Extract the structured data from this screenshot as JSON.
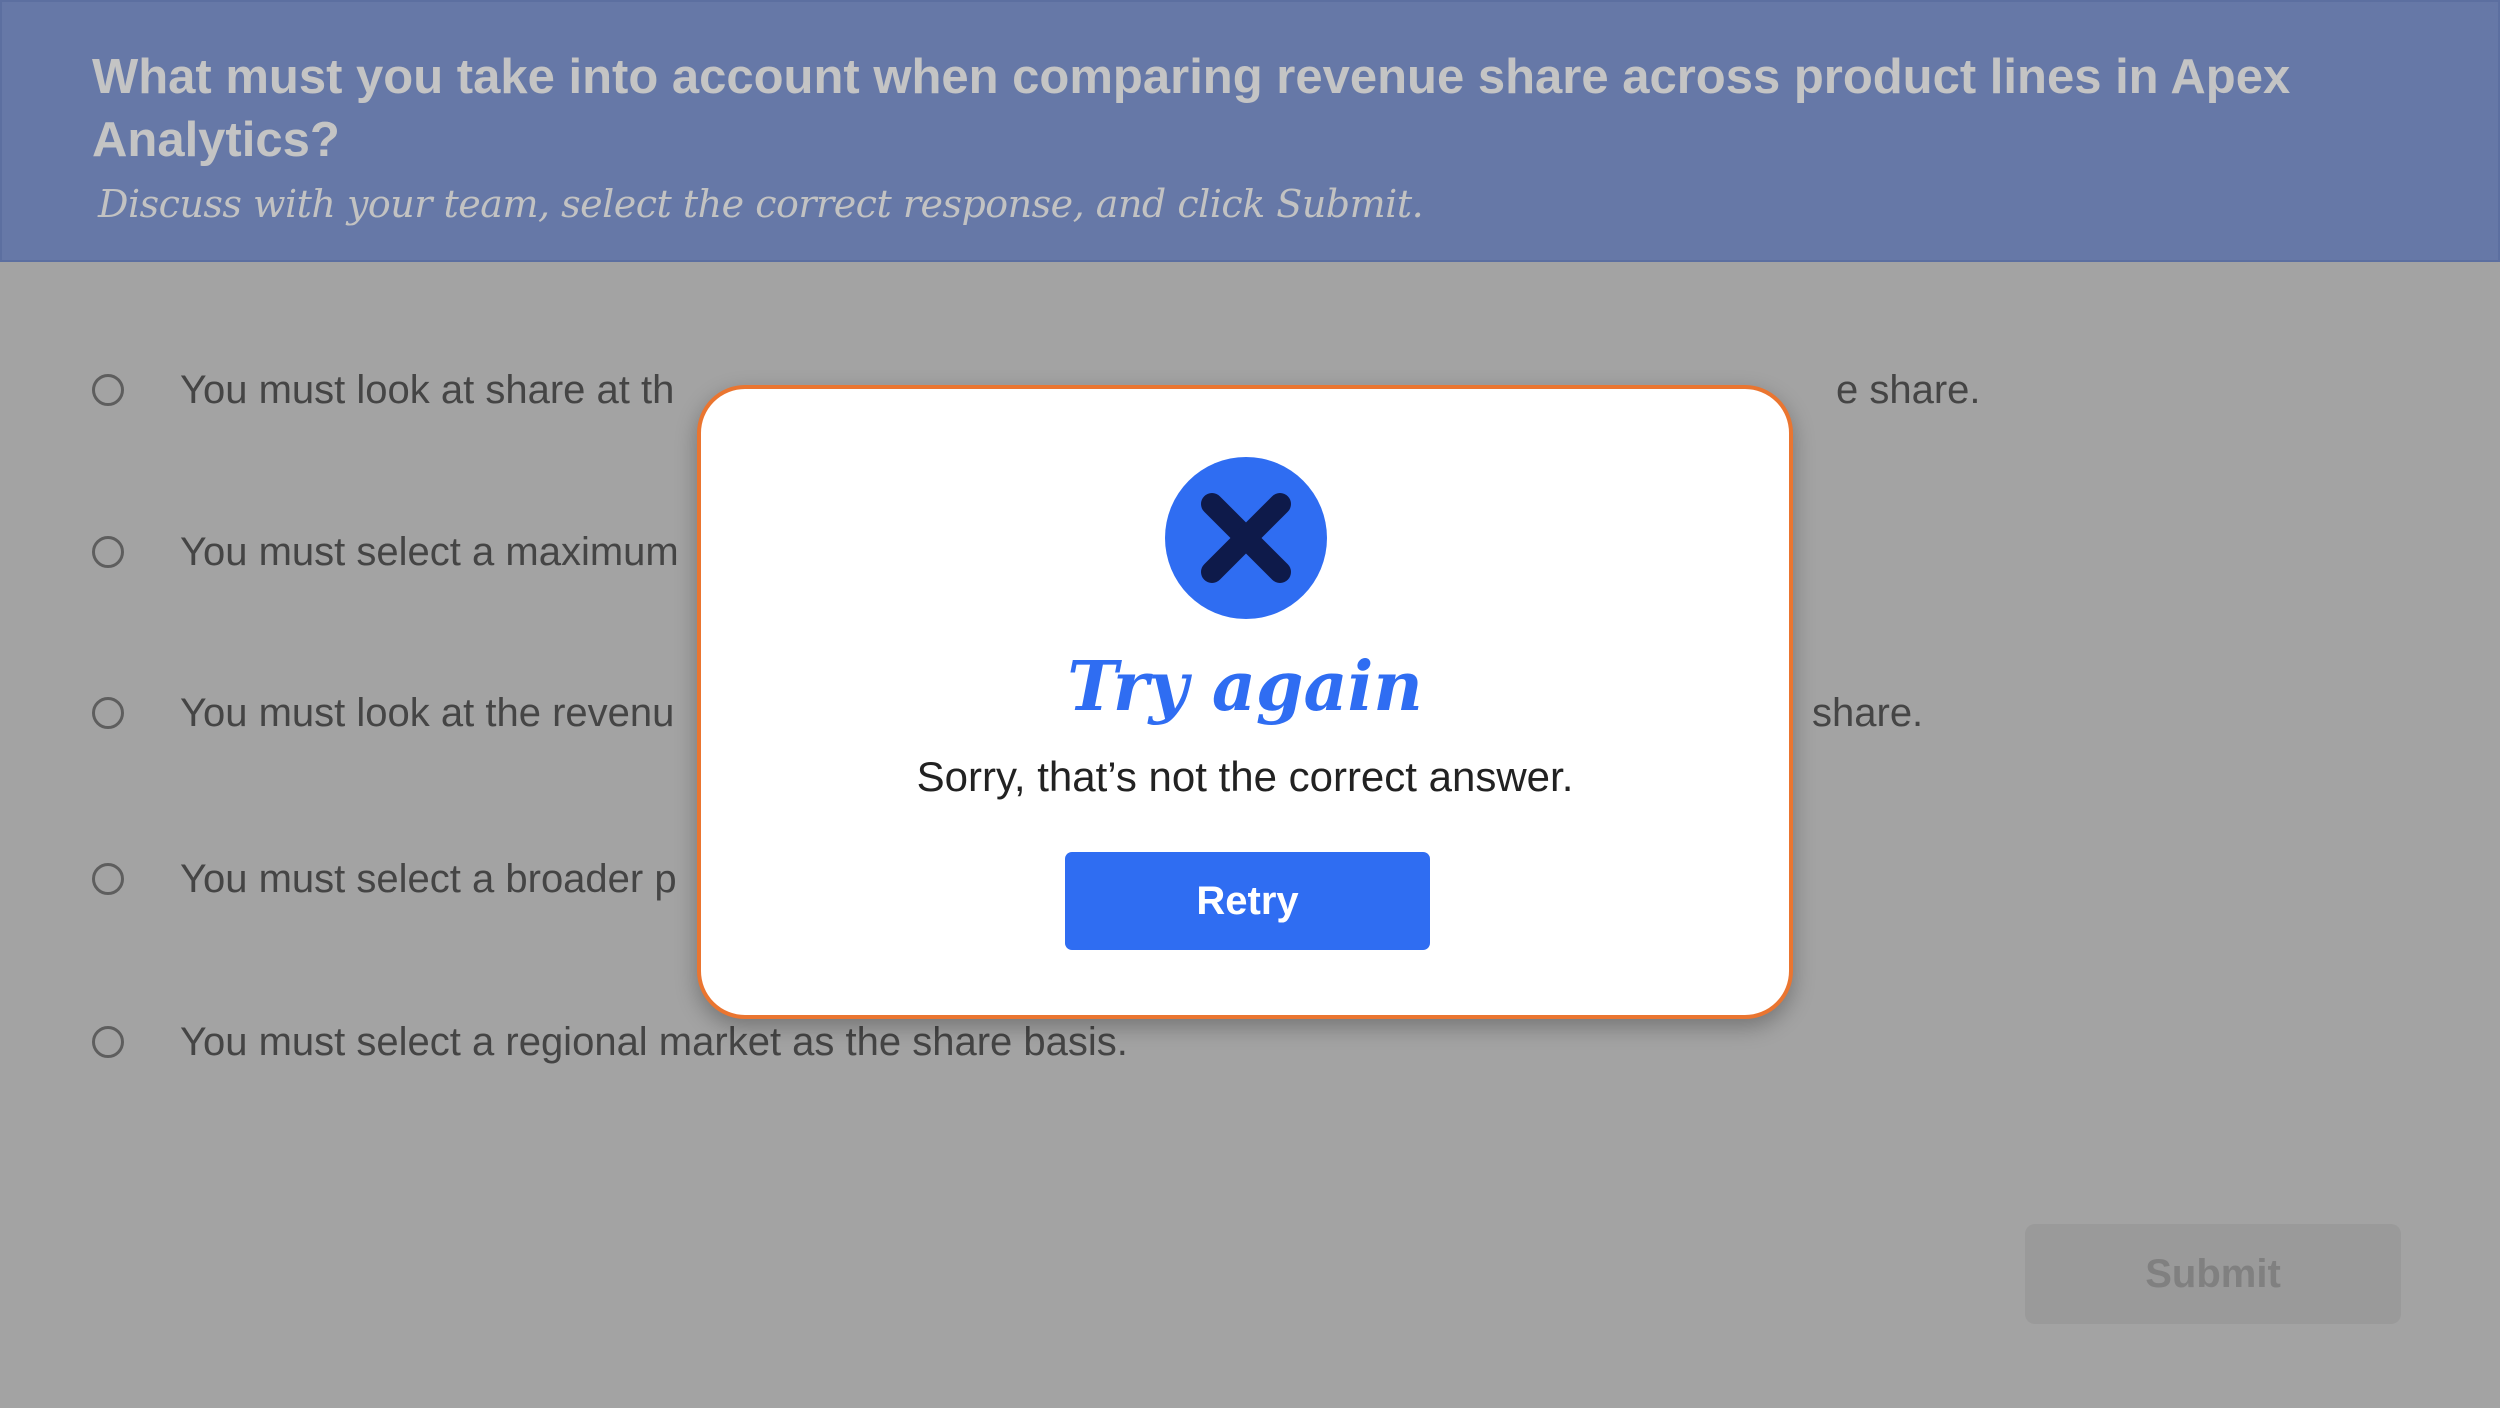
{
  "question": {
    "title": "What must you take into account when comparing revenue share across product lines in Apex Analytics?",
    "instructions": "Discuss with your team, select the correct response, and click Submit."
  },
  "options": [
    {
      "label": "You must look at share at th",
      "trailing_text": "e share.",
      "selected": false
    },
    {
      "label": "You must select a maximum",
      "trailing_text": "",
      "selected": false
    },
    {
      "label": "You must look at the revenu",
      "trailing_text": "share.",
      "selected": false
    },
    {
      "label": "You must select a broader p",
      "trailing_text": "",
      "selected": false
    },
    {
      "label": "You must select a regional market as the share basis.",
      "trailing_text": "",
      "selected": false
    }
  ],
  "submit_label": "Submit",
  "feedback_modal": {
    "icon": "close-icon",
    "title": "Try again",
    "message": "Sorry, that’s not the correct answer.",
    "retry_label": "Retry"
  },
  "colors": {
    "header_bg": "#6678a7",
    "overlay_bg": "#a3a3a3",
    "accent_blue": "#2f6df2",
    "modal_border": "#ea7530",
    "icon_x": "#0e1a4a"
  }
}
